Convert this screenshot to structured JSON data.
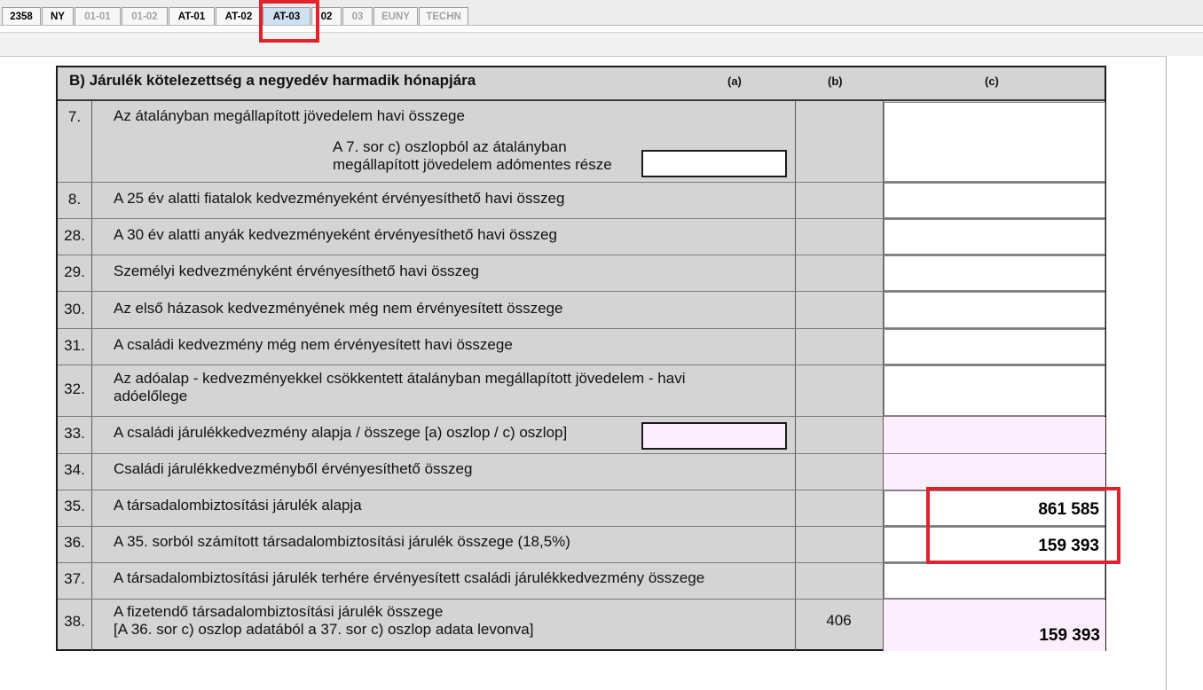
{
  "tabs": [
    {
      "label": "2358",
      "state": "normal"
    },
    {
      "label": "NY",
      "state": "normal"
    },
    {
      "label": "01-01",
      "state": "dim"
    },
    {
      "label": "01-02",
      "state": "dim"
    },
    {
      "label": "AT-01",
      "state": "normal"
    },
    {
      "label": "AT-02",
      "state": "normal"
    },
    {
      "label": "AT-03",
      "state": "active"
    },
    {
      "label": "02",
      "state": "normal"
    },
    {
      "label": "03",
      "state": "dim"
    },
    {
      "label": "EUNY",
      "state": "dim"
    },
    {
      "label": "TECHN",
      "state": "dim"
    }
  ],
  "section": {
    "title": "B) Járulék kötelezettség a negyedév harmadik hónapjára",
    "col_a": "(a)",
    "col_b": "(b)",
    "col_c": "(c)"
  },
  "rows": {
    "r7": {
      "num": "7.",
      "label": "Az átalányban megállapított jövedelem havi összege",
      "sub1": "A 7. sor c) oszlopból az átalányban",
      "sub2": "megállapított jövedelem adómentes része",
      "sub_value": "",
      "c": ""
    },
    "r8": {
      "num": "8.",
      "label": "A 25 év alatti fiatalok kedvezményeként érvényesíthető havi összeg",
      "c": ""
    },
    "r28": {
      "num": "28.",
      "label": "A 30 év alatti anyák kedvezményeként érvényesíthető havi összeg",
      "c": ""
    },
    "r29": {
      "num": "29.",
      "label": "Személyi kedvezményként érvényesíthető havi összeg",
      "c": ""
    },
    "r30": {
      "num": "30.",
      "label": "Az első házasok kedvezményének még nem érvényesített összege",
      "c": ""
    },
    "r31": {
      "num": "31.",
      "label": "A családi kedvezmény még nem érvényesített havi összege",
      "c": ""
    },
    "r32": {
      "num": "32.",
      "line1": "Az adóalap - kedvezményekkel csökkentett átalányban megállapított jövedelem - havi",
      "line2": "adóelőlege",
      "c": ""
    },
    "r33": {
      "num": "33.",
      "label": "A családi járulékkedvezmény alapja / összege [a) oszlop / c) oszlop]",
      "a": "",
      "c": ""
    },
    "r34": {
      "num": "34.",
      "label": "Családi járulékkedvezményből érvényesíthető összeg",
      "c": ""
    },
    "r35": {
      "num": "35.",
      "label": "A társadalombiztosítási járulék alapja",
      "c": "861 585"
    },
    "r36": {
      "num": "36.",
      "label": "A 35. sorból számított társadalombiztosítási járulék összege (18,5%)",
      "c": "159 393"
    },
    "r37": {
      "num": "37.",
      "label": "A társadalombiztosítási járulék terhére érvényesített családi járulékkedvezmény összege",
      "c": ""
    },
    "r38": {
      "num": "38.",
      "line1": "A fizetendő társadalombiztosítási járulék összege",
      "line2": "[A 36. sor c) oszlop adatából a 37. sor c) oszlop adata levonva]",
      "b": "406",
      "c": "159 393"
    }
  },
  "colors": {
    "highlight": "#e0222b",
    "pink_field": "#fdeefd",
    "form_bg": "#d4d4d4"
  }
}
